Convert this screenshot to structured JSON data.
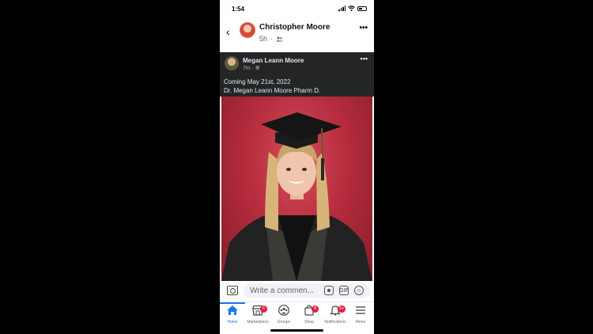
{
  "status_bar": {
    "time": "1:54"
  },
  "header": {
    "name": "Christopher Moore",
    "time": "5h"
  },
  "shared_post": {
    "author": "Megan Leann Moore",
    "time": "7m",
    "caption_line1": "Coming May 21st, 2022",
    "caption_line2": "Dr. Megan Leann Moore Pharm D."
  },
  "comment": {
    "placeholder": "Write a commen...",
    "gif_label": "GIF"
  },
  "tabs": [
    {
      "label": "Home",
      "icon": "home-icon",
      "badge": ""
    },
    {
      "label": "Marketplace",
      "icon": "marketplace-icon",
      "badge": "6"
    },
    {
      "label": "Groups",
      "icon": "groups-icon",
      "badge": ""
    },
    {
      "label": "Shop",
      "icon": "shop-icon",
      "badge": "6"
    },
    {
      "label": "Notifications",
      "icon": "bell-icon",
      "badge": "9+"
    },
    {
      "label": "Menu",
      "icon": "menu-icon",
      "badge": ""
    }
  ],
  "colors": {
    "accent": "#1877f2",
    "badge": "#e41e3f",
    "dark_card": "#242526",
    "photo_bg": "#b82d3e"
  }
}
